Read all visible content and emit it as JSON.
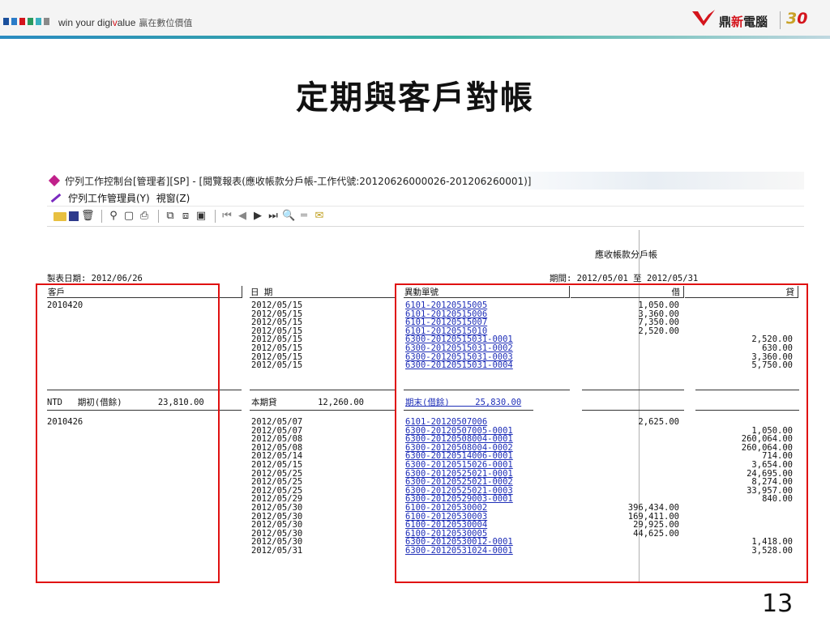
{
  "header": {
    "slogan_prefix": "win your digi",
    "slogan_v": "v",
    "slogan_suffix": "alue",
    "slogan_cn": "贏在數位價值",
    "brand_cn_1": "鼎",
    "brand_cn_2": "新",
    "brand_cn_3": "電腦",
    "anniversary_3": "3",
    "anniversary_0": "0",
    "colors": {
      "accent_red": "#d4141c",
      "accent_gold": "#c9a227",
      "accent_teal": "#3ab0a0"
    }
  },
  "slide": {
    "title": "定期與客戶對帳",
    "page_number": "13"
  },
  "window": {
    "title": "佇列工作控制台[管理者][SP] - [閱覽報表(應收帳款分戶帳-工作代號:20120626000026-201206260001)]",
    "menu": {
      "item1": "佇列工作管理員(Y)",
      "item2": "視窗(Z)"
    },
    "toolbar_icons": [
      "open-folder-icon",
      "save-icon",
      "delete-icon",
      "search-print-icon",
      "print-preview-icon",
      "printer-icon",
      "export-icon",
      "copy-icon",
      "settings-icon",
      "first-page-icon",
      "prev-page-icon",
      "next-page-icon",
      "last-page-icon",
      "find-icon",
      "separator-icon",
      "mail-icon"
    ]
  },
  "report": {
    "title": "應收帳款分戶帳",
    "date_line": "製表日期: 2012/06/26",
    "period_line": "期間: 2012/05/01 至 2012/05/31",
    "headers": {
      "customer": "客戶",
      "date": "日 期",
      "voucher": "異動單號",
      "debit": "借",
      "credit": "貸"
    },
    "group1": {
      "customer": "2010420",
      "dates": "2012/05/15\n2012/05/15\n2012/05/15\n2012/05/15\n2012/05/15\n2012/05/15\n2012/05/15\n2012/05/15",
      "vouchers": [
        "6101-20120515005",
        "6101-20120515006",
        "6101-20120515007",
        "6101-20120515010",
        "6300-20120515031-0001",
        "6300-20120515031-0002",
        "6300-20120515031-0003",
        "6300-20120515031-0004"
      ],
      "debits": "1,050.00\n3,360.00\n7,350.00\n2,520.00\n\n\n\n",
      "credits": "\n\n\n\n2,520.00\n630.00\n3,360.00\n5,750.00"
    },
    "summary": {
      "opening": "NTD   期初(借餘)       23,810.00",
      "period_credit": "本期貸        12,260.00",
      "closing": "期末(借餘)     25,830.00"
    },
    "group2": {
      "customer": "2010426",
      "dates": "2012/05/07\n2012/05/07\n2012/05/08\n2012/05/08\n2012/05/14\n2012/05/15\n2012/05/25\n2012/05/25\n2012/05/25\n2012/05/29\n2012/05/30\n2012/05/30\n2012/05/30\n2012/05/30\n2012/05/30\n2012/05/31",
      "vouchers": [
        "6101-20120507006",
        "6300-20120507005-0001",
        "6300-20120508004-0001",
        "6300-20120508004-0002",
        "6300-20120514006-0001",
        "6300-20120515026-0001",
        "6300-20120525021-0001",
        "6300-20120525021-0002",
        "6300-20120525021-0003",
        "6300-20120529003-0001",
        "6100-20120530002",
        "6100-20120530003",
        "6100-20120530004",
        "6100-20120530005",
        "6300-20120530012-0001",
        "6300-20120531024-0001"
      ],
      "debits": "2,625.00\n\n\n\n\n\n\n\n\n\n396,434.00\n169,411.00\n29,925.00\n44,625.00\n\n",
      "credits": "\n1,050.00\n260,064.00\n260,064.00\n714.00\n3,654.00\n24,695.00\n8,274.00\n33,957.00\n840.00\n\n\n\n\n1,418.00\n3,528.00"
    }
  }
}
